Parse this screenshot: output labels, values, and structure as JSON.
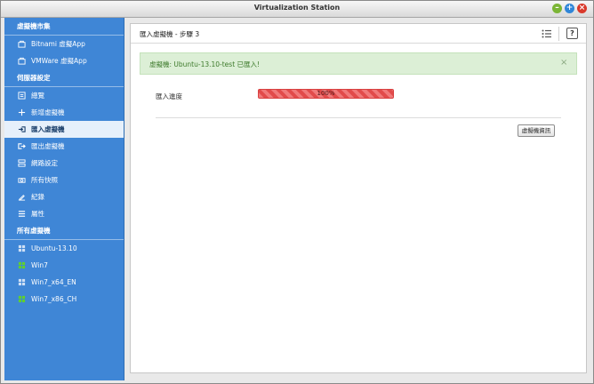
{
  "window": {
    "title": "Virtualization Station"
  },
  "sidebar": {
    "sections": [
      {
        "label": "虛擬機市集",
        "items": [
          {
            "label": "Bitnami 虛擬App",
            "icon": "marketplace-icon"
          },
          {
            "label": "VMWare 虛擬App",
            "icon": "marketplace-icon"
          }
        ]
      },
      {
        "label": "伺服器設定",
        "items": [
          {
            "label": "總覽",
            "icon": "overview-icon"
          },
          {
            "label": "新增虛擬機",
            "icon": "plus-icon"
          },
          {
            "label": "匯入虛擬機",
            "icon": "import-icon",
            "active": true
          },
          {
            "label": "匯出虛擬機",
            "icon": "export-icon"
          },
          {
            "label": "網路設定",
            "icon": "network-icon"
          },
          {
            "label": "所有快照",
            "icon": "snapshot-icon"
          },
          {
            "label": "紀錄",
            "icon": "log-icon"
          },
          {
            "label": "屬性",
            "icon": "properties-icon"
          }
        ]
      },
      {
        "label": "所有虛擬機",
        "items": [
          {
            "label": "Ubuntu-13.10",
            "icon": "vm-icon",
            "status": "stopped"
          },
          {
            "label": "Win7",
            "icon": "vm-icon",
            "status": "running"
          },
          {
            "label": "Win7_x64_EN",
            "icon": "vm-icon",
            "status": "stopped"
          },
          {
            "label": "Win7_x86_CH",
            "icon": "vm-icon",
            "status": "running"
          }
        ]
      }
    ]
  },
  "main": {
    "title": "匯入虛擬機 - 步驟 3",
    "alert": {
      "message": "虛擬機: Ubuntu-13.10-test 已匯入!",
      "close": "×"
    },
    "progress": {
      "label": "匯入進度",
      "text": "100%",
      "percent": 100
    },
    "button": {
      "label": "虛擬機資訊"
    }
  },
  "colors": {
    "sidebar": "#3f86d6",
    "active_item": "#e6f0fb",
    "alert_bg": "#dcefd6",
    "alert_text": "#3d7a2b",
    "progress": "#e24b4b",
    "vm_stopped": "#2f6fc0",
    "vm_running": "#4caf2a"
  }
}
